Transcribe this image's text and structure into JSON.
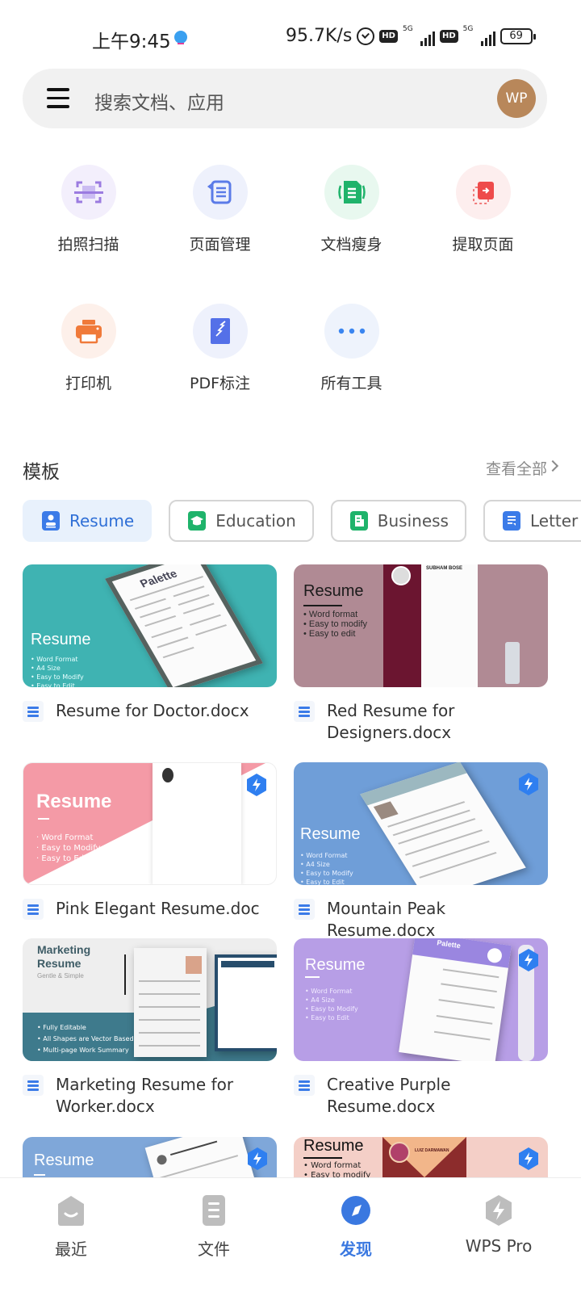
{
  "status_bar": {
    "time": "上午9:45",
    "network_speed": "95.7K/s",
    "sim1": {
      "hd": "HD",
      "network": "5G"
    },
    "sim2": {
      "hd": "HD",
      "network": "5G"
    },
    "battery": "69"
  },
  "search": {
    "placeholder": "搜索文档、应用",
    "avatar_initials": "WP",
    "menu_icon": "hamburger-menu-icon"
  },
  "tools": [
    {
      "label": "拍照扫描",
      "icon": "scan-icon",
      "color": "#9b7be0",
      "bg": "#f3effc"
    },
    {
      "label": "页面管理",
      "icon": "page-manage-icon",
      "color": "#5b7be8",
      "bg": "#eef1fc"
    },
    {
      "label": "文档瘦身",
      "icon": "compress-doc-icon",
      "color": "#1fb36b",
      "bg": "#e8f8ef"
    },
    {
      "label": "提取页面",
      "icon": "extract-page-icon",
      "color": "#ee4b4b",
      "bg": "#fdeeee"
    },
    {
      "label": "打印机",
      "icon": "printer-icon",
      "color": "#f07a3a",
      "bg": "#fdf0ea"
    },
    {
      "label": "PDF标注",
      "icon": "pdf-annotate-icon",
      "color": "#5470e8",
      "bg": "#eef1fc"
    },
    {
      "label": "所有工具",
      "icon": "more-icon",
      "color": "#3a85f0",
      "bg": "#eef3fc"
    }
  ],
  "templates": {
    "title": "模板",
    "see_all": "查看全部",
    "categories": [
      {
        "label": "Resume",
        "icon": "resume-icon",
        "active": true,
        "color": "#3b7be8"
      },
      {
        "label": "Education",
        "icon": "education-icon",
        "active": false,
        "color": "#1fb36b"
      },
      {
        "label": "Business",
        "icon": "business-icon",
        "active": false,
        "color": "#1fb36b"
      },
      {
        "label": "Letter",
        "icon": "letter-icon",
        "active": false,
        "color": "#3b7be8"
      }
    ],
    "items": [
      {
        "name": "Resume for Doctor.docx",
        "thumb_title": "Resume",
        "thumb_bullets": [
          "• Word Format",
          "• A4 Size",
          "• Easy to Modify",
          "• Easy to Edit"
        ],
        "paper_title": "Palette",
        "pro": false,
        "bg": "#3fb3b2"
      },
      {
        "name": "Red Resume for Designers.docx",
        "thumb_title": "Resume",
        "thumb_bullets": [
          "• Word format",
          "• Easy to modify",
          "• Easy to edit"
        ],
        "paper_title": "SUBHAM BOSE",
        "pro": false,
        "bg": "#b08a94"
      },
      {
        "name": "Pink Elegant Resume.doc",
        "thumb_title": "Resume",
        "thumb_bullets": [
          "· Word Format",
          "· Easy to Modify",
          "· Easy to Edit"
        ],
        "pro": true,
        "bg": "#f49aa6"
      },
      {
        "name": "Mountain Peak Resume.docx",
        "thumb_title": "Resume",
        "thumb_bullets": [
          "• Word Format",
          "• A4 Size",
          "• Easy to Modify",
          "• Easy to Edit"
        ],
        "pro": true,
        "bg": "#6f9ed8"
      },
      {
        "name": "Marketing Resume for Worker.docx",
        "thumb_title": "Marketing Resume",
        "thumb_subtitle": "Gentle & Simple",
        "thumb_bullets": [
          "• Fully Editable",
          "• All Shapes are Vector Based",
          "• Multi-page Work Summary"
        ],
        "pro": false,
        "bg": "#3e7a8c"
      },
      {
        "name": "Creative  Purple Resume.docx",
        "thumb_title": "Resume",
        "thumb_bullets": [
          "• Word Format",
          "• A4 Size",
          "• Easy to Modify",
          "• Easy to Edit"
        ],
        "paper_title": "Palette",
        "pro": true,
        "bg": "#b79ee6"
      },
      {
        "name": "",
        "thumb_title": "Resume",
        "pro": true,
        "bg": "#7fa7d9"
      },
      {
        "name": "",
        "thumb_title": "Resume",
        "thumb_bullets": [
          "• Word format",
          "• Easy to modify"
        ],
        "paper_title": "LUIZ DARMAWAN",
        "pro": true,
        "bg": "#f4cfc7"
      }
    ]
  },
  "bottom_nav": [
    {
      "label": "最近",
      "icon": "recent-icon",
      "active": false
    },
    {
      "label": "文件",
      "icon": "files-icon",
      "active": false
    },
    {
      "label": "发现",
      "icon": "discover-compass-icon",
      "active": true
    },
    {
      "label": "WPS Pro",
      "icon": "wps-pro-icon",
      "active": false
    }
  ],
  "colors": {
    "accent": "#3a78e0",
    "pro_badge": "#2f7ff0",
    "inactive_nav": "#bdbdbd"
  }
}
